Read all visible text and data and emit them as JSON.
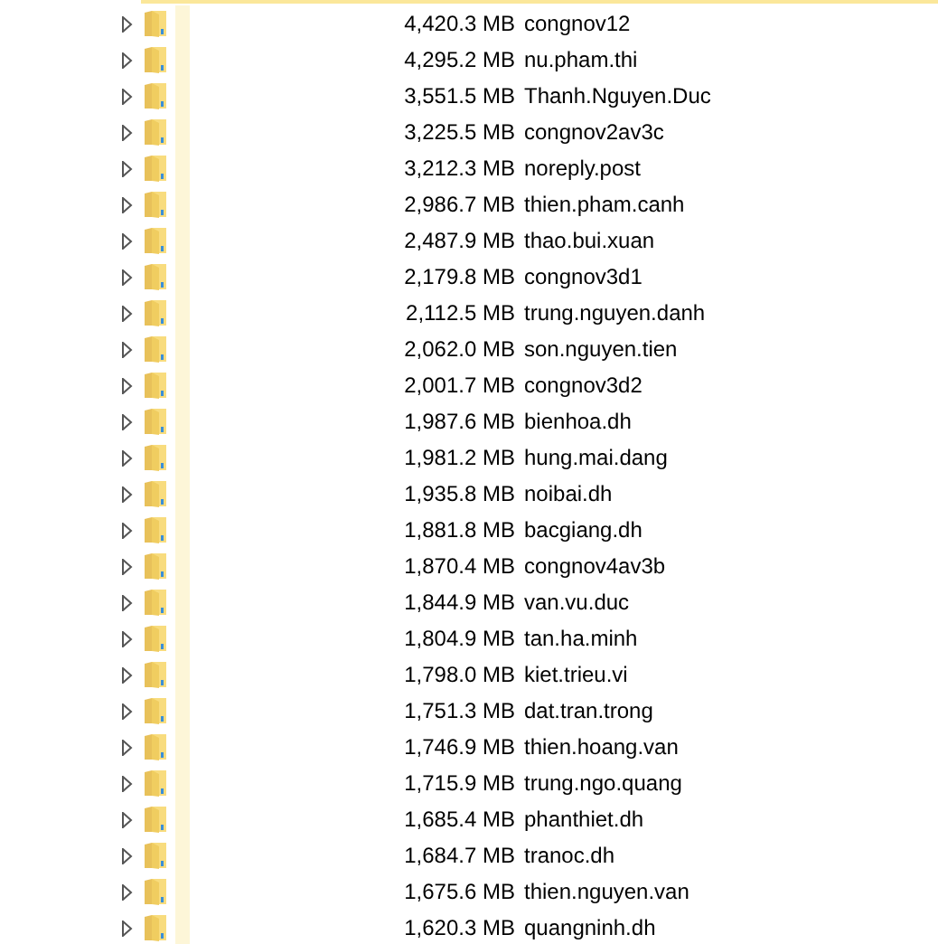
{
  "rows": [
    {
      "size": "4,420.3 MB",
      "name": "congnov12",
      "expanded": false
    },
    {
      "size": "4,295.2 MB",
      "name": "nu.pham.thi",
      "expanded": false
    },
    {
      "size": "3,551.5 MB",
      "name": "Thanh.Nguyen.Duc",
      "expanded": false
    },
    {
      "size": "3,225.5 MB",
      "name": "congnov2av3c",
      "expanded": false
    },
    {
      "size": "3,212.3 MB",
      "name": "noreply.post",
      "expanded": false
    },
    {
      "size": "2,986.7 MB",
      "name": "thien.pham.canh",
      "expanded": false
    },
    {
      "size": "2,487.9 MB",
      "name": "thao.bui.xuan",
      "expanded": false
    },
    {
      "size": "2,179.8 MB",
      "name": "congnov3d1",
      "expanded": false
    },
    {
      "size": "2,112.5 MB",
      "name": "trung.nguyen.danh",
      "expanded": false
    },
    {
      "size": "2,062.0 MB",
      "name": "son.nguyen.tien",
      "expanded": false
    },
    {
      "size": "2,001.7 MB",
      "name": "congnov3d2",
      "expanded": false
    },
    {
      "size": "1,987.6 MB",
      "name": "bienhoa.dh",
      "expanded": false
    },
    {
      "size": "1,981.2 MB",
      "name": "hung.mai.dang",
      "expanded": false
    },
    {
      "size": "1,935.8 MB",
      "name": "noibai.dh",
      "expanded": false
    },
    {
      "size": "1,881.8 MB",
      "name": "bacgiang.dh",
      "expanded": false
    },
    {
      "size": "1,870.4 MB",
      "name": "congnov4av3b",
      "expanded": false
    },
    {
      "size": "1,844.9 MB",
      "name": "van.vu.duc",
      "expanded": false
    },
    {
      "size": "1,804.9 MB",
      "name": "tan.ha.minh",
      "expanded": false
    },
    {
      "size": "1,798.0 MB",
      "name": "kiet.trieu.vi",
      "expanded": false
    },
    {
      "size": "1,751.3 MB",
      "name": "dat.tran.trong",
      "expanded": false
    },
    {
      "size": "1,746.9 MB",
      "name": "thien.hoang.van",
      "expanded": false
    },
    {
      "size": "1,715.9 MB",
      "name": "trung.ngo.quang",
      "expanded": false
    },
    {
      "size": "1,685.4 MB",
      "name": "phanthiet.dh",
      "expanded": false
    },
    {
      "size": "1,684.7 MB",
      "name": "tranoc.dh",
      "expanded": false
    },
    {
      "size": "1,675.6 MB",
      "name": "thien.nguyen.van",
      "expanded": false
    },
    {
      "size": "1,620.3 MB",
      "name": "quangninh.dh",
      "expanded": false
    }
  ]
}
